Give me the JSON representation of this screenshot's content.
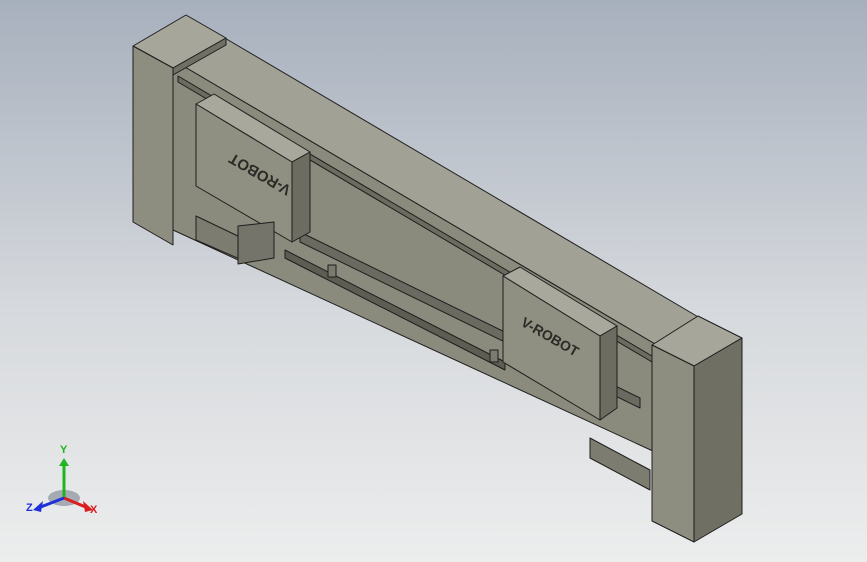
{
  "viewport": {
    "model": "linear-module-assembly",
    "carriage_logo_text": "V-ROBOT",
    "colors": {
      "bg_top": "#a7b0bd",
      "bg_bottom": "#eceded",
      "body": "#8b8b7e",
      "body_dark": "#6f6f63",
      "edge": "#1e1e1e"
    }
  },
  "triad": {
    "x_label": "X",
    "y_label": "Y",
    "z_label": "Z",
    "colors": {
      "x": "#d91f1f",
      "y": "#1fb51f",
      "z": "#1f2fd9"
    }
  }
}
